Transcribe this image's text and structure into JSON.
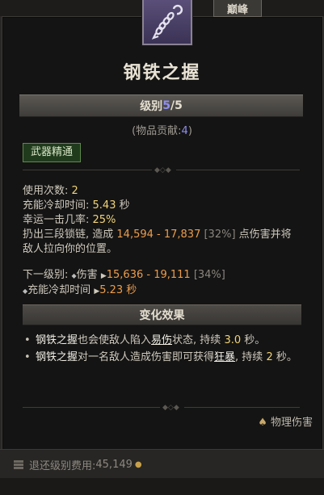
{
  "header": {
    "peak_tab": "巅峰",
    "icon": "chain-hook-icon"
  },
  "skill": {
    "name": "钢铁之握",
    "rank_prefix": "级别",
    "rank_current": "5",
    "rank_sep": "/",
    "rank_max": "5",
    "contrib_prefix": "(物品贡献:",
    "contrib_value": "4",
    "contrib_suffix": ")",
    "tag": "武器精通"
  },
  "stats": {
    "uses_label": "使用次数: ",
    "uses_value": "2",
    "cooldown_label": "充能冷却时间: ",
    "cooldown_value": "5.43",
    "cooldown_unit": " 秒",
    "lucky_label": "幸运一击几率: ",
    "lucky_value": "25%",
    "desc_a": "扔出三段锁链, 造成 ",
    "desc_dmg": "14,594 - 17,837",
    "desc_pct": " [32%]",
    "desc_b": " 点伤害并将敌人拉向你的位置。"
  },
  "next_level": {
    "label": "下一级别: ",
    "dmg_label": "伤害",
    "dmg_value": "15,636 - 19,111",
    "dmg_pct": " [34%]",
    "cd_label": "充能冷却时间",
    "cd_value": "5.23 秒"
  },
  "effects": {
    "title": "变化效果",
    "b1_skill": "钢铁之握",
    "b1_a": "也会使敌人陷入",
    "b1_kw": "易伤",
    "b1_b": "状态, 持续 ",
    "b1_val": "3.0",
    "b1_c": " 秒。",
    "b2_skill": "钢铁之握",
    "b2_a": "对一名敌人造成伤害即可获得",
    "b2_kw": "狂暴",
    "b2_b": ", 持续 ",
    "b2_val": "2",
    "b2_c": " 秒。"
  },
  "footer": {
    "damage_type": "物理伤害",
    "refund_label": "退还级别费用: ",
    "refund_value": "45,149"
  },
  "colors": {
    "rank_value": "#8f8ff0",
    "highlight": "#f2d479",
    "damage": "#ec9d4c",
    "tag_bg": "#1f3b1c"
  }
}
